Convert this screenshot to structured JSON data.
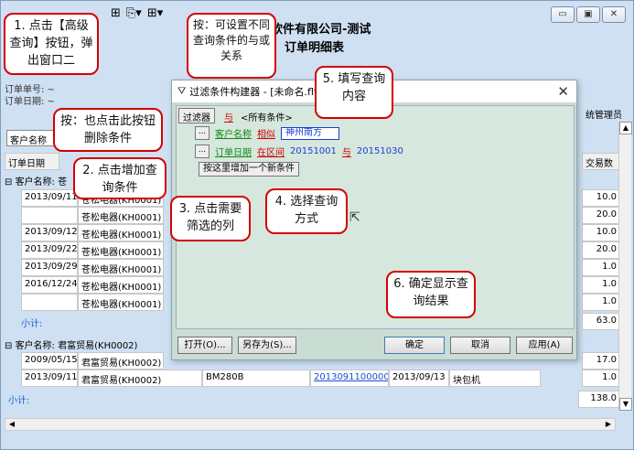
{
  "window": {
    "minimize": "▭",
    "maximize": "▣",
    "close": "✕"
  },
  "report": {
    "title1": "软件有限公司-测试",
    "title2": "订单明细表",
    "order_no": "订单单号: ~",
    "order_date": "订单日期: ~",
    "operator": "统管理员",
    "filter_combo": "客户名称",
    "col_order_date": "订单日期",
    "col_amount": "交易数"
  },
  "groups": [
    {
      "label": "客户名称: 苍",
      "rows": [
        {
          "date": "2013/09/11",
          "customer": "苍松电器(KH0001)",
          "amount": "10.0"
        },
        {
          "date": "",
          "customer": "苍松电器(KH0001)",
          "amount": "20.0"
        },
        {
          "date": "2013/09/12",
          "customer": "苍松电器(KH0001)",
          "amount": "10.0"
        },
        {
          "date": "2013/09/22",
          "customer": "苍松电器(KH0001)",
          "amount": "20.0"
        },
        {
          "date": "2013/09/29",
          "customer": "苍松电器(KH0001)",
          "amount": "1.0"
        },
        {
          "date": "2016/12/24",
          "customer": "苍松电器(KH0001)",
          "amount": "1.0"
        },
        {
          "date": "",
          "customer": "苍松电器(KH0001)",
          "amount": "1.0"
        }
      ],
      "subtotal_label": "小计:",
      "subtotal": "63.0"
    },
    {
      "label": "客户名称: 君富贸易(KH0002)",
      "rows": [
        {
          "date": "2009/05/15",
          "customer": "君富贸易(KH0002)",
          "model": "",
          "link": "",
          "date2": "",
          "product": "",
          "amount": "17.0"
        },
        {
          "date": "2013/09/11",
          "customer": "君富贸易(KH0002)",
          "model": "BM280B",
          "link": "20130911000002",
          "date2": "2013/09/13",
          "product": "块包机",
          "amount": "1.0"
        }
      ],
      "subtotal_label": "小计:",
      "subtotal": "138.0"
    }
  ],
  "dialog": {
    "title": "过滤条件构建器 - [未命名.flt]",
    "filter_btn": "过滤器",
    "and_label": "与",
    "all_conditions": "<所有条件>",
    "dot_btn": "...",
    "cond1": {
      "field": "客户名称",
      "op": "相似",
      "value": "神州南方"
    },
    "cond2": {
      "field": "订单日期",
      "op": "在区间",
      "from": "20151001",
      "and": "与",
      "to": "20151030"
    },
    "add_btn": "按这里增加一个新条件",
    "open_btn": "打开(O)...",
    "save_btn": "另存为(S)...",
    "ok_btn": "确定",
    "cancel_btn": "取消",
    "apply_btn": "应用(A)"
  },
  "callouts": {
    "c1": "1. 点击【高级查询】按钮，弹出窗口二",
    "c_and": "按：可设置不同查询条件的与或关系",
    "c5": "5. 填写查询内容",
    "c_del": "按：也点击此按钮删除条件",
    "c2": "2. 点击增加查询条件",
    "c3": "3. 点击需要筛选的列",
    "c4": "4. 选择查询方式",
    "c6": "6. 确定显示查询结果"
  },
  "colors": {
    "callout_border": "#d40000",
    "dialog_bg": "#c9ddd4",
    "link": "#1a4fd6",
    "field_green": "#118a11"
  }
}
